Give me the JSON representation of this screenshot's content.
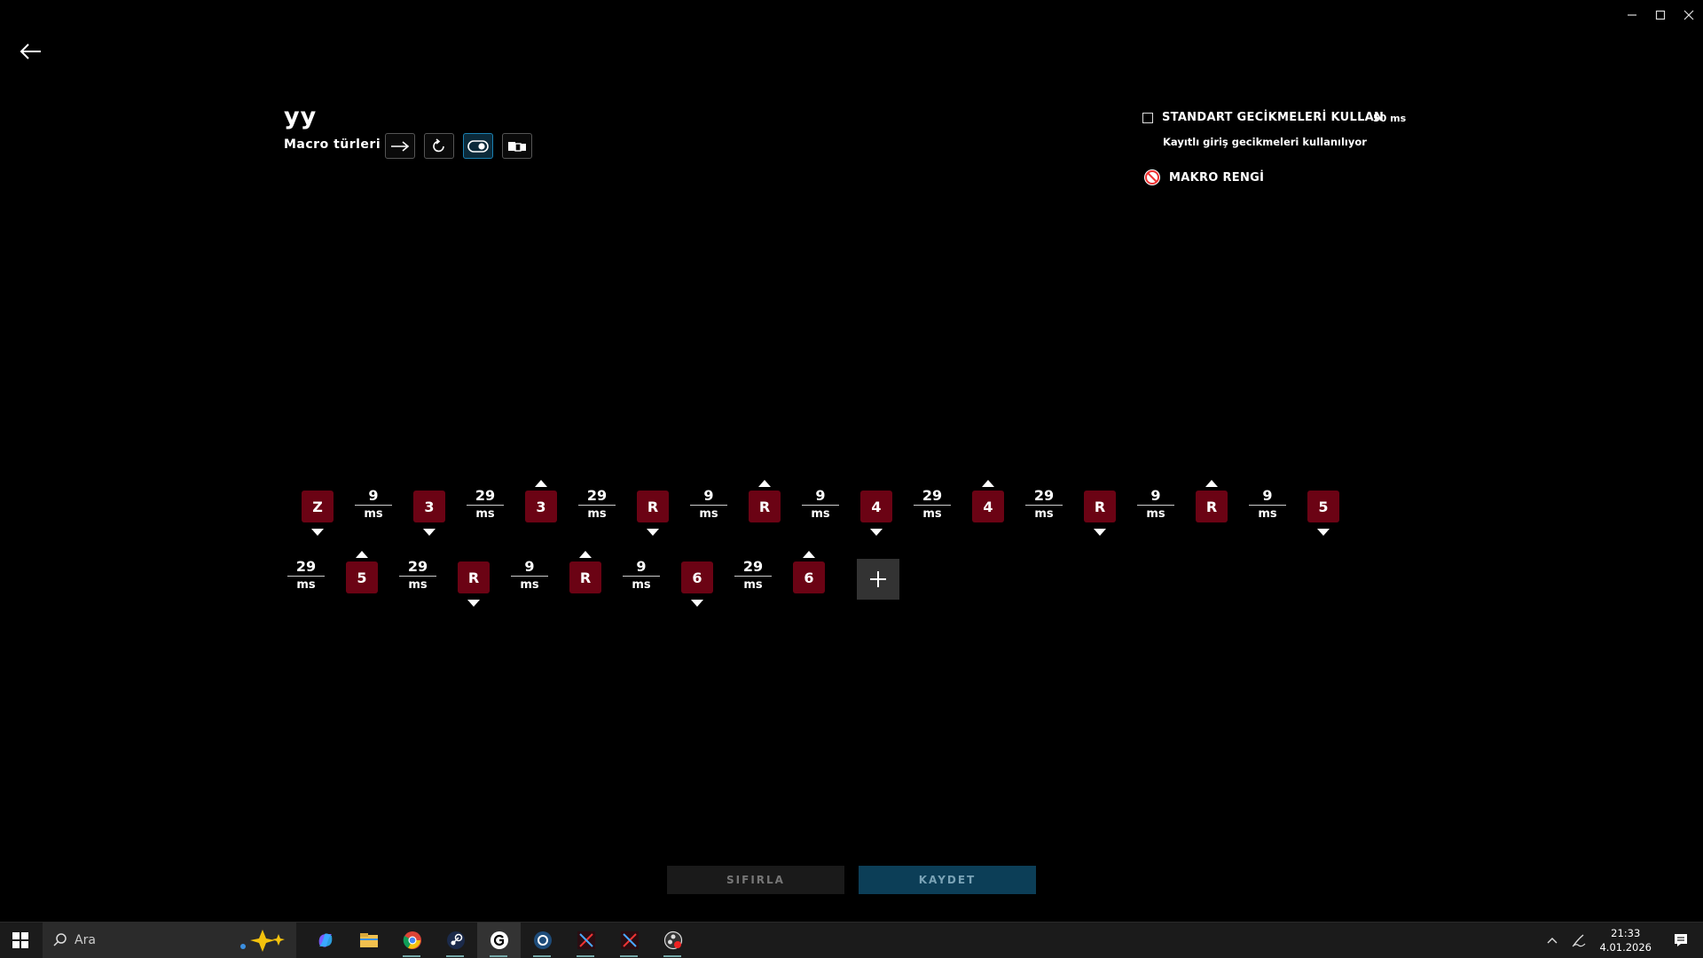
{
  "window_controls": {
    "minimize": "minimize",
    "maximize": "maximize",
    "close": "close"
  },
  "macro": {
    "name": "yy",
    "types_label": "Macro türleri",
    "types": [
      {
        "icon": "arrow-right-icon",
        "active": false
      },
      {
        "icon": "repeat-icon",
        "active": false
      },
      {
        "icon": "toggle-icon",
        "active": true
      },
      {
        "icon": "sequence-icon",
        "active": false
      }
    ]
  },
  "settings": {
    "standard_delay_label": "STANDART GECİKMELERİ KULLAN",
    "standard_delay_value": "50 ms",
    "standard_delay_checked": false,
    "recorded_delay_note": "Kayıtlı giriş gecikmeleri kullanılıyor",
    "macro_color_label": "MAKRO RENGİ"
  },
  "sequence": [
    {
      "type": "key",
      "label": "Z",
      "dir": "down"
    },
    {
      "type": "delay",
      "value": "9",
      "unit": "ms"
    },
    {
      "type": "key",
      "label": "3",
      "dir": "down"
    },
    {
      "type": "delay",
      "value": "29",
      "unit": "ms"
    },
    {
      "type": "key",
      "label": "3",
      "dir": "up"
    },
    {
      "type": "delay",
      "value": "29",
      "unit": "ms"
    },
    {
      "type": "key",
      "label": "R",
      "dir": "down"
    },
    {
      "type": "delay",
      "value": "9",
      "unit": "ms"
    },
    {
      "type": "key",
      "label": "R",
      "dir": "up"
    },
    {
      "type": "delay",
      "value": "9",
      "unit": "ms"
    },
    {
      "type": "key",
      "label": "4",
      "dir": "down"
    },
    {
      "type": "delay",
      "value": "29",
      "unit": "ms"
    },
    {
      "type": "key",
      "label": "4",
      "dir": "up"
    },
    {
      "type": "delay",
      "value": "29",
      "unit": "ms"
    },
    {
      "type": "key",
      "label": "R",
      "dir": "down"
    },
    {
      "type": "delay",
      "value": "9",
      "unit": "ms"
    },
    {
      "type": "key",
      "label": "R",
      "dir": "up"
    },
    {
      "type": "delay",
      "value": "9",
      "unit": "ms"
    },
    {
      "type": "key",
      "label": "5",
      "dir": "down"
    },
    {
      "type": "delay",
      "value": "29",
      "unit": "ms"
    },
    {
      "type": "key",
      "label": "5",
      "dir": "up"
    },
    {
      "type": "delay",
      "value": "29",
      "unit": "ms"
    },
    {
      "type": "key",
      "label": "R",
      "dir": "down"
    },
    {
      "type": "delay",
      "value": "9",
      "unit": "ms"
    },
    {
      "type": "key",
      "label": "R",
      "dir": "up"
    },
    {
      "type": "delay",
      "value": "9",
      "unit": "ms"
    },
    {
      "type": "key",
      "label": "6",
      "dir": "down"
    },
    {
      "type": "delay",
      "value": "29",
      "unit": "ms"
    },
    {
      "type": "key",
      "label": "6",
      "dir": "up"
    }
  ],
  "actions": {
    "reset": "SIFIRLA",
    "save": "KAYDET"
  },
  "taskbar": {
    "search_placeholder": "Ara",
    "apps": [
      "copilot-icon",
      "file-explorer-icon",
      "chrome-icon",
      "steam-icon",
      "g-hub-icon",
      "app-icon",
      "game-icon",
      "game2-icon",
      "obs-icon"
    ],
    "time": "21:33",
    "date": "4.01.2026"
  },
  "colors": {
    "key_bg": "#6b0314",
    "accent": "#1a7fb0",
    "save_bg": "#0c3e57"
  }
}
